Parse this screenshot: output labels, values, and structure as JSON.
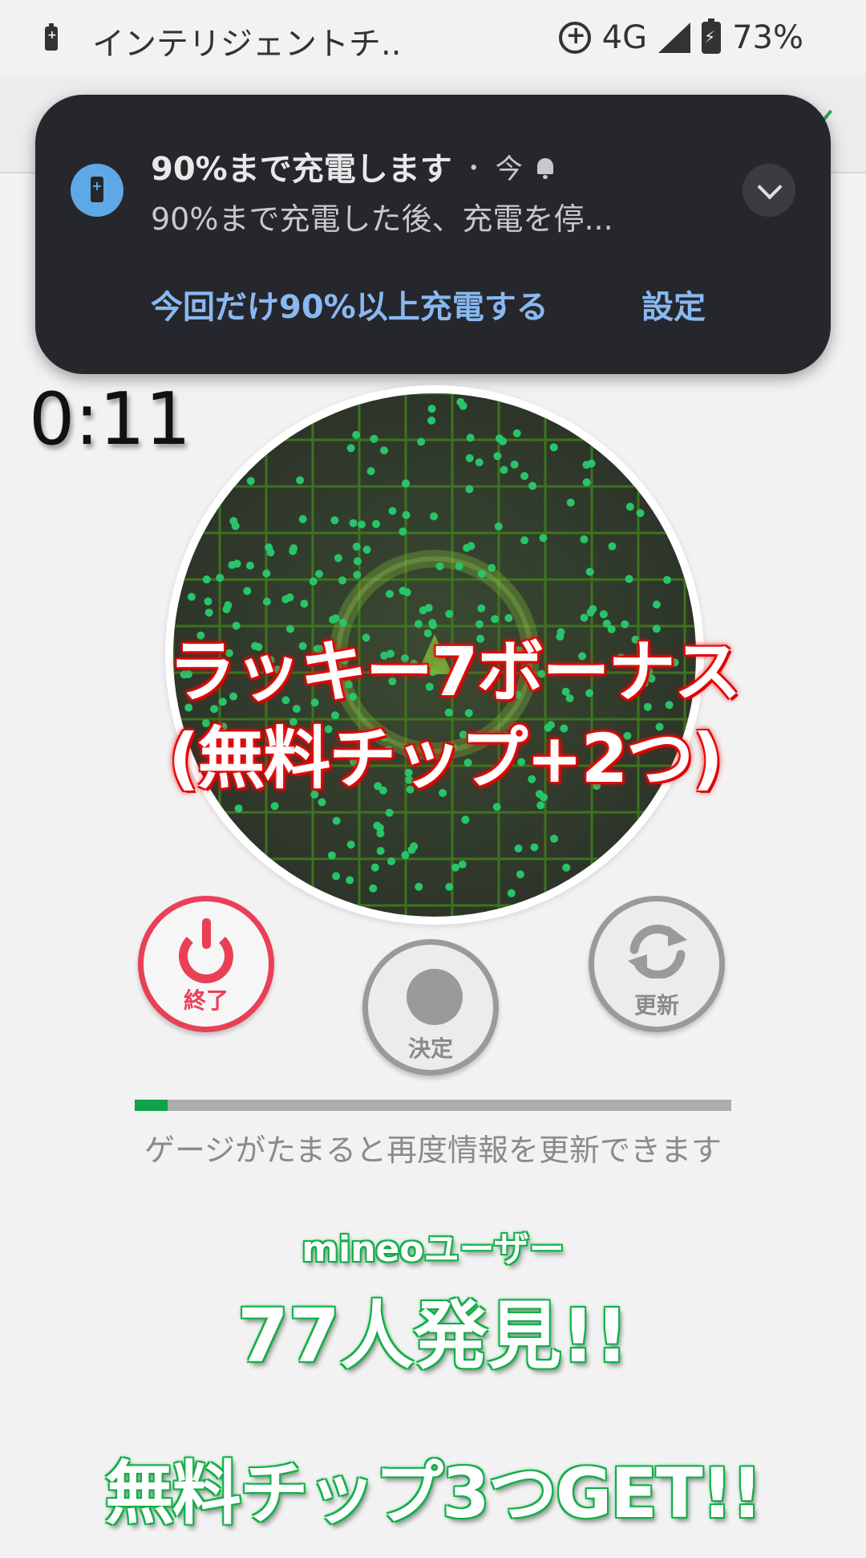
{
  "status_bar": {
    "app_title": "インテリジェントチ..",
    "network": "4G",
    "battery_percent": "73%"
  },
  "notification": {
    "title": "90%まで充電します",
    "separator": "・",
    "time": "今",
    "body": "90%まで充電した後、充電を停...",
    "actions": {
      "charge_above": "今回だけ90%以上充電する",
      "settings": "設定"
    }
  },
  "timer": {
    "value": "0:11"
  },
  "radar": {
    "bonus_line1": "ラッキー7ボーナス",
    "bonus_line2": "(無料チップ+2つ)"
  },
  "controls": {
    "end_label": "終了",
    "decide_label": "決定",
    "refresh_label": "更新"
  },
  "gauge": {
    "progress": 0.055,
    "caption": "ゲージがたまると再度情報を更新できます"
  },
  "result": {
    "users_label": "mineoユーザー",
    "found_count": "77人発見!!",
    "chip_get": "無料チップ3つGET!!"
  },
  "colors": {
    "accent_red": "#e94057",
    "accent_green": "#0ea24b",
    "notification_bg": "#25272c",
    "notification_action": "#8ab8f0"
  }
}
